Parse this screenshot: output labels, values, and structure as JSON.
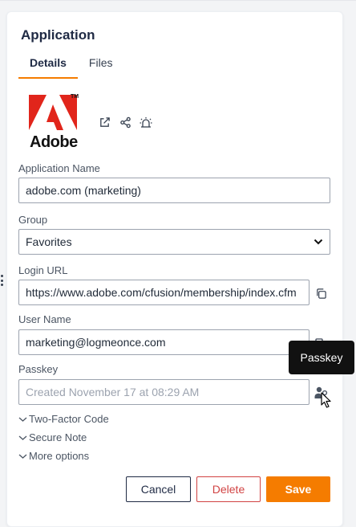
{
  "panel": {
    "title": "Application",
    "tabs": [
      {
        "label": "Details",
        "active": true
      },
      {
        "label": "Files",
        "active": false
      }
    ]
  },
  "app": {
    "logo_text": "Adobe",
    "logo_tm": "TM",
    "logo_color": "#e1251b",
    "action_icons": [
      "external-link-icon",
      "share-icon",
      "alarm-icon"
    ]
  },
  "fields": {
    "application_name": {
      "label": "Application Name",
      "value": "adobe.com (marketing)"
    },
    "group": {
      "label": "Group",
      "value": "Favorites"
    },
    "login_url": {
      "label": "Login URL",
      "value": "https://www.adobe.com/cfusion/membership/index.cfm"
    },
    "user_name": {
      "label": "User Name",
      "value": "marketing@logmeonce.com"
    },
    "passkey": {
      "label": "Passkey",
      "placeholder": "Created November 17 at 08:29 AM"
    }
  },
  "expanders": {
    "two_factor": "Two-Factor Code",
    "secure_note": "Secure Note",
    "more_options": "More options"
  },
  "buttons": {
    "cancel": "Cancel",
    "delete": "Delete",
    "save": "Save"
  },
  "tooltip": {
    "text": "Passkey"
  },
  "colors": {
    "accent": "#f57c00",
    "danger": "#d14343",
    "navy": "#1f2a44"
  }
}
